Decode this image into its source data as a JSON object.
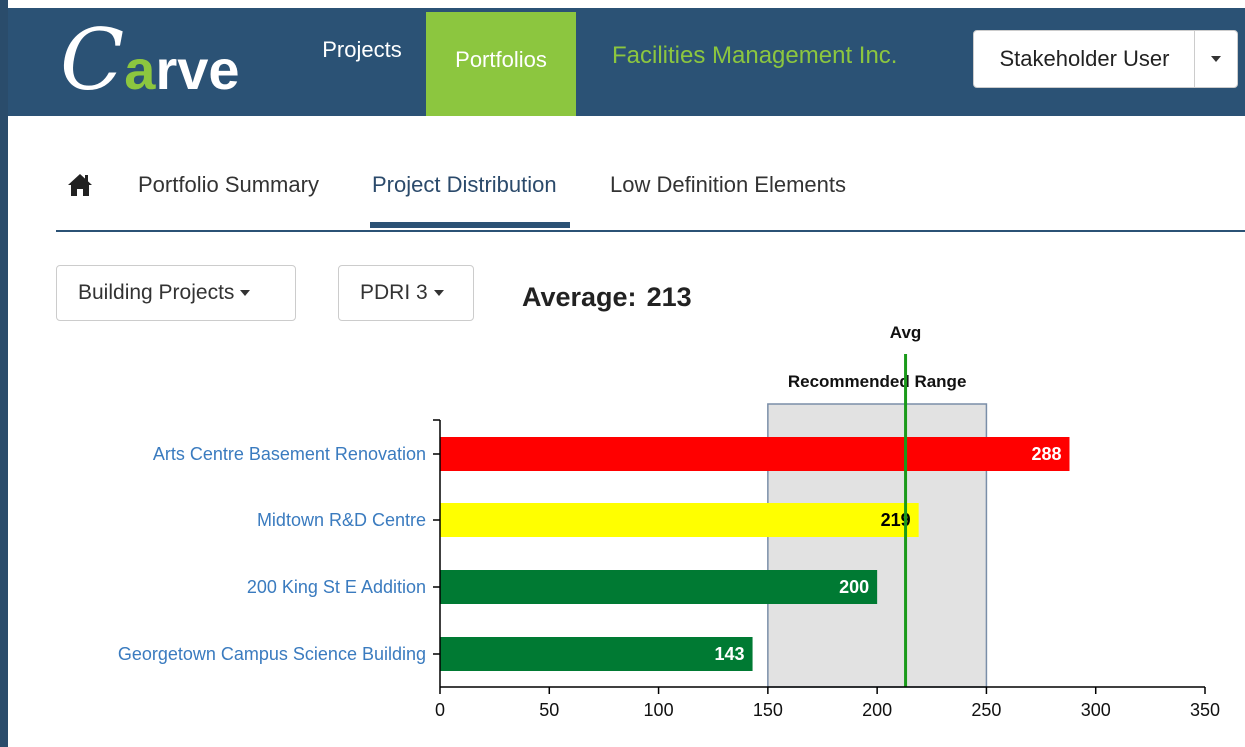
{
  "navbar": {
    "logo": {
      "letter_c": "C",
      "letter_a": "a",
      "rest": "rve"
    },
    "projects_label": "Projects",
    "portfolios_label": "Portfolios",
    "org_name": "Facilities Management Inc.",
    "user_label": "Stakeholder User",
    "colors": {
      "bg": "#2b5275",
      "accent": "#8cc63f"
    }
  },
  "tabs": [
    {
      "label": "",
      "icon": "home-icon"
    },
    {
      "label": "Portfolio Summary"
    },
    {
      "label": "Project Distribution",
      "active": true
    },
    {
      "label": "Low Definition Elements"
    }
  ],
  "filters": {
    "project_type": "Building Projects",
    "index": "PDRI 3"
  },
  "average": {
    "label": "Average:",
    "value": "213"
  },
  "chart_data": {
    "type": "bar",
    "orientation": "horizontal",
    "categories": [
      "Arts Centre Basement Renovation",
      "Midtown R&D Centre",
      "200 King St E Addition",
      "Georgetown Campus Science Building"
    ],
    "values": [
      288,
      219,
      200,
      143
    ],
    "bar_colors": [
      "#ff0000",
      "#ffff00",
      "#007a33",
      "#007a33"
    ],
    "label_colors": [
      "#ffffff",
      "#000000",
      "#ffffff",
      "#ffffff"
    ],
    "xlim": [
      0,
      350
    ],
    "xticks": [
      0,
      50,
      100,
      150,
      200,
      250,
      300,
      350
    ],
    "avg": {
      "label": "Avg",
      "value": 213,
      "color": "#1a9a1a"
    },
    "recommended_range": {
      "label": "Recommended Range",
      "from": 150,
      "to": 250,
      "fill": "#e2e2e2",
      "stroke": "#7a8ea8"
    }
  }
}
